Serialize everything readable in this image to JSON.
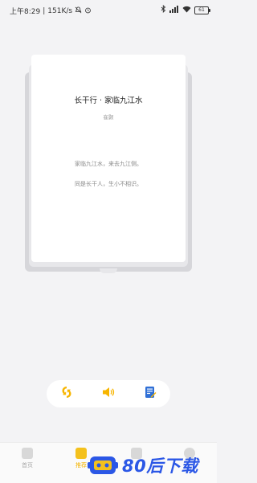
{
  "status_bar": {
    "time": "上午8:29",
    "network_speed": "151K/s",
    "battery": "61"
  },
  "poem": {
    "title": "长干行 · 家临九江水",
    "author": "崔颢",
    "lines": [
      "家临九江水，来去九江侧。",
      "同是长干人，生小不相识。"
    ]
  },
  "actions": {
    "refresh_icon": "refresh-icon",
    "audio_icon": "speaker-icon",
    "notes_icon": "notes-icon"
  },
  "tabs": [
    {
      "label": "首页",
      "icon": "home-icon"
    },
    {
      "label": "推荐",
      "icon": "recommend-icon"
    },
    {
      "label": "",
      "icon": "edit-icon"
    },
    {
      "label": "",
      "icon": "profile-icon"
    }
  ],
  "watermark": {
    "text": "80后下载"
  },
  "colors": {
    "accent_yellow": "#f4c11c",
    "icon_orange": "#f7b500",
    "icon_blue": "#2f6fd6",
    "watermark_blue": "#2b57e6"
  }
}
